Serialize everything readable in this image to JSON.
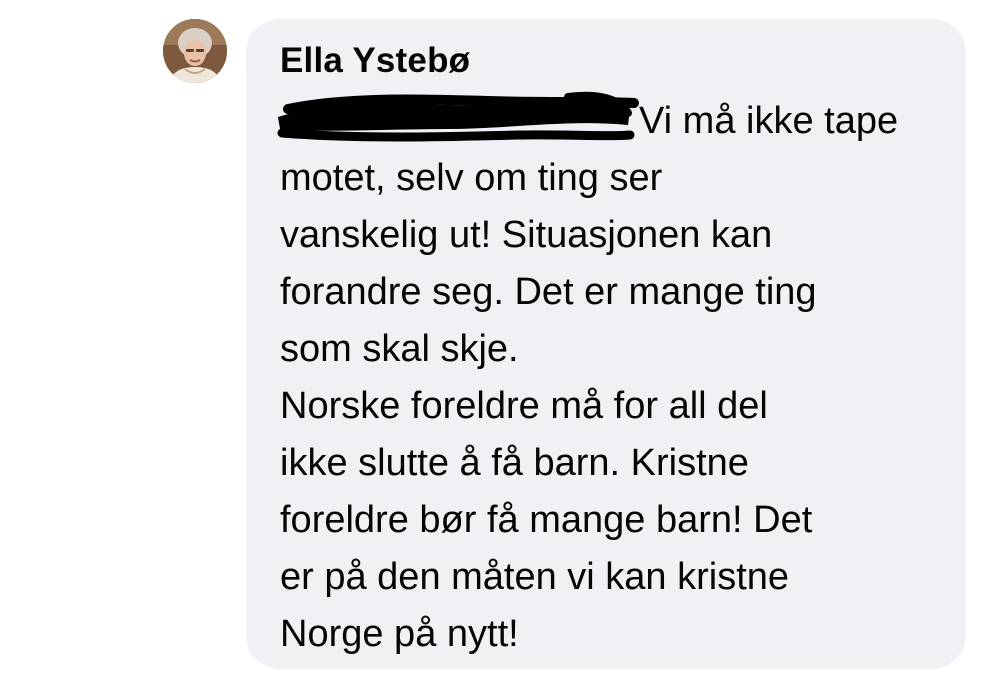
{
  "comment": {
    "author": "Ella Ystebø",
    "mention_label": "",
    "lines": [
      "Vi må ikke tape",
      "motet, selv om ting ser",
      "vanskelig ut! Situasjonen kan",
      "forandre seg. Det er mange ting",
      "som skal skje.",
      "Norske foreldre må for all del",
      "ikke slutte å få barn. Kristne",
      "foreldre bør få mange barn! Det",
      "er på den måten vi kan kristne",
      "Norge på nytt!"
    ]
  },
  "colors": {
    "bubble_background": "#eff1f5",
    "text": "#050505",
    "mention": "#1877f2",
    "redaction": "#000000"
  },
  "icons": {
    "avatar": "profile-photo"
  }
}
